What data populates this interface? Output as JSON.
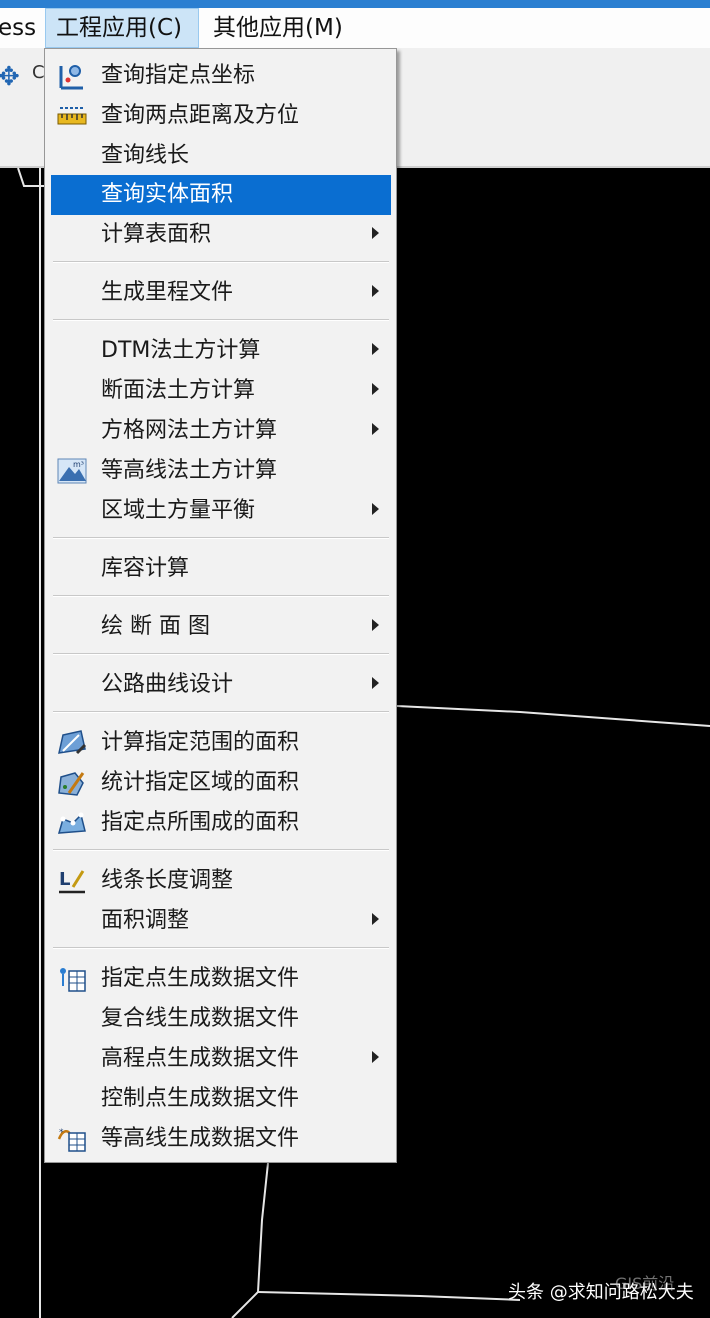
{
  "menubar": {
    "left_fragment": "ess",
    "engineering": "工程应用(C)",
    "other": "其他应用(M)"
  },
  "toolbar": {
    "partial_glyph": "C"
  },
  "menu": {
    "items": [
      {
        "label": "查询指定点坐标",
        "icon": "point-coordinate-icon"
      },
      {
        "label": "查询两点距离及方位",
        "icon": "ruler-icon"
      },
      {
        "label": "查询线长"
      },
      {
        "label": "查询实体面积",
        "highlighted": true
      },
      {
        "label": "计算表面积",
        "submenu": true
      },
      {
        "label": "生成里程文件",
        "submenu": true
      },
      {
        "label": "DTM法土方计算",
        "submenu": true
      },
      {
        "label": "断面法土方计算",
        "submenu": true
      },
      {
        "label": "方格网法土方计算",
        "submenu": true
      },
      {
        "label": "等高线法土方计算",
        "icon": "contour-volume-icon"
      },
      {
        "label": "区域土方量平衡",
        "submenu": true
      },
      {
        "label": "库容计算"
      },
      {
        "label": "绘 断 面 图",
        "submenu": true
      },
      {
        "label": "公路曲线设计",
        "submenu": true
      },
      {
        "label": "计算指定范围的面积",
        "icon": "range-area-icon"
      },
      {
        "label": "统计指定区域的面积",
        "icon": "region-area-icon"
      },
      {
        "label": "指定点所围成的面积",
        "icon": "points-area-icon"
      },
      {
        "label": "线条长度调整",
        "icon": "line-length-icon"
      },
      {
        "label": "面积调整",
        "submenu": true
      },
      {
        "label": "指定点生成数据文件",
        "icon": "points-datafile-icon"
      },
      {
        "label": "复合线生成数据文件"
      },
      {
        "label": "高程点生成数据文件",
        "submenu": true
      },
      {
        "label": "控制点生成数据文件"
      },
      {
        "label": "等高线生成数据文件",
        "icon": "contour-datafile-icon"
      }
    ]
  },
  "watermark": {
    "text": "头条 @求知问路松大夫",
    "overlay_text": "GIS前沿"
  }
}
